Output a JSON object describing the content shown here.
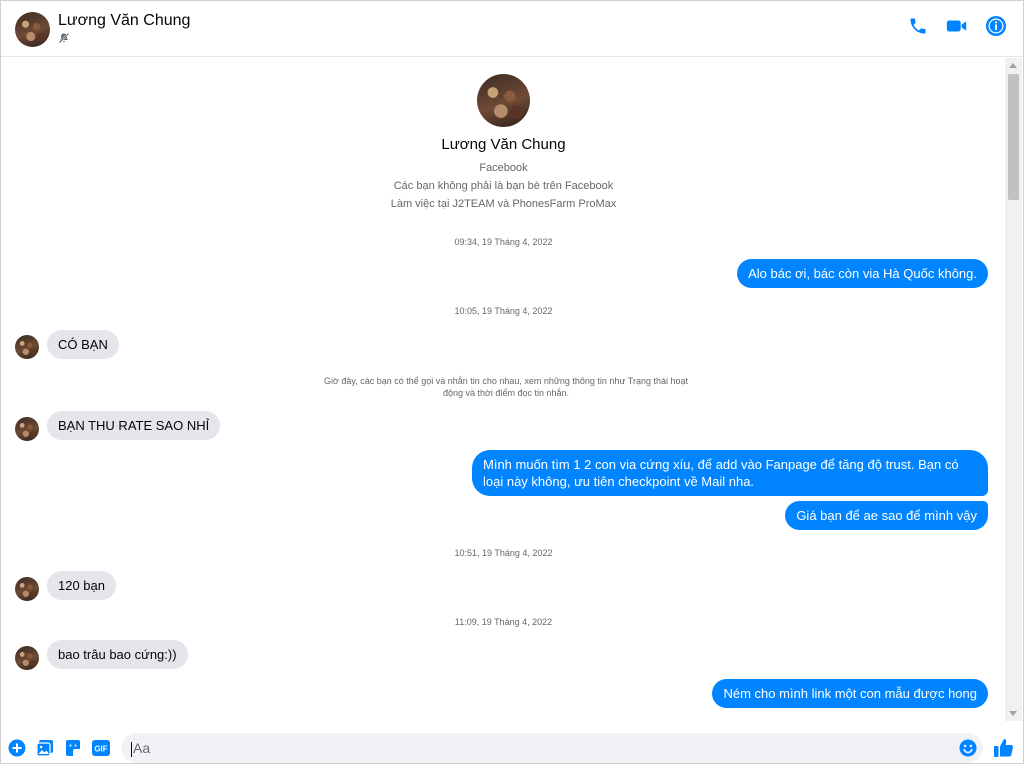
{
  "colors": {
    "accent": "#0084ff",
    "incoming_bubble": "#e4e6eb",
    "meta_text": "#65676b"
  },
  "header": {
    "contact_name": "Lương Văn Chung",
    "status_icon": "bell-slash-icon",
    "actions": [
      "phone-icon",
      "video-camera-icon",
      "info-icon"
    ]
  },
  "profile": {
    "name": "Lương Văn Chung",
    "platform": "Facebook",
    "friendship": "Các bạn không phải là bạn bè trên Facebook",
    "work": "Làm việc tại J2TEAM và PhonesFarm ProMax"
  },
  "timestamps": {
    "t1": "09:34, 19 Tháng 4, 2022",
    "t2": "10:05, 19 Tháng 4, 2022",
    "t3": "10:51, 19 Tháng 4, 2022",
    "t4": "11:09, 19 Tháng 4, 2022"
  },
  "messages": {
    "m1": "Alo bác ơi, bác còn via Hà Quốc không.",
    "m2": "CÓ BẠN",
    "m3": "BẠN THU RATE SAO NHỈ",
    "m4": "Mình muốn tìm 1 2 con via cứng xíu, để add vào Fanpage để tăng độ trust. Bạn có loại này không, ưu tiên checkpoint về Mail nha.",
    "m5": "Giá bạn để ae sao để mình vậy",
    "m6": "120 bạn",
    "m7": "bao trâu bao cứng:))",
    "m8": "Ném cho mình link một con mẫu được hong"
  },
  "system_notice": "Giờ đây, các bạn có thể gọi và nhắn tin cho nhau, xem những thông tin như Trạng thái hoạt động và thời điểm đọc tin nhắn.",
  "composer": {
    "placeholder": "Aa",
    "tools": [
      "plus-icon",
      "image-icon",
      "sticker-icon",
      "gif-icon"
    ],
    "gif_label": "GIF",
    "emoji_icon": "smile-icon",
    "send_icon": "thumbs-up-icon"
  }
}
